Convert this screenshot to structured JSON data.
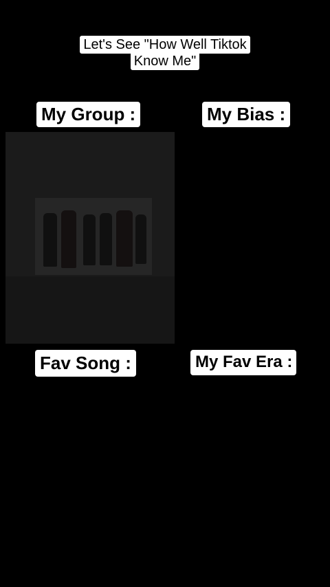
{
  "title": {
    "line1": "Let's See \"How Well Tiktok",
    "line2": "Know Me\""
  },
  "labels": {
    "group": "My Group :",
    "bias": "My Bias :",
    "song": "Fav Song :",
    "era": "My Fav Era :"
  }
}
